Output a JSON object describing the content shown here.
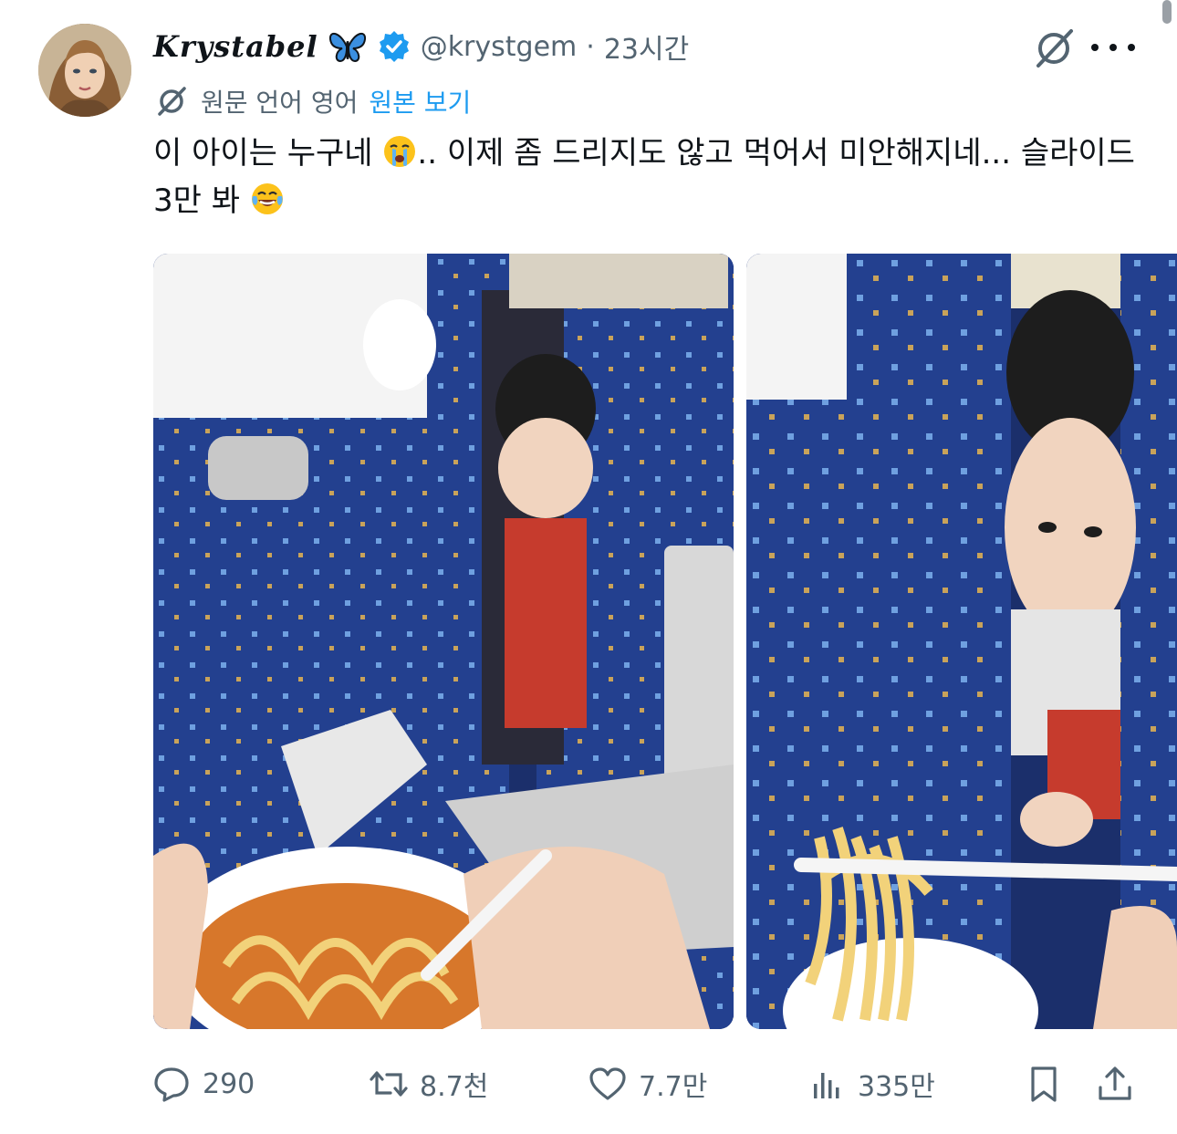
{
  "tweet": {
    "author": {
      "display_name": "Krystabel",
      "name_emoji": "butterfly-emoji",
      "handle": "@krystgem",
      "separator": "·",
      "timestamp": "23시간",
      "verified": true,
      "verified_color": "#1d9bf0"
    },
    "translation": {
      "notice": "원문 언어 영어",
      "show_original_label": "원본 보기",
      "link_color": "#1d9bf0"
    },
    "text": {
      "part1": "이 아이는 누구네 ",
      "emoji1": "loudly-crying-face-emoji",
      "part2": ".. 이제 좀 드리지도 않고 먹어서 미안해지네... 슬라이드 3만 봐 ",
      "emoji2": "face-with-tears-of-joy-emoji"
    },
    "media": [
      {
        "icon": "photo-baby-airplane-seat-ramen"
      },
      {
        "icon": "photo-baby-closeup-noodles"
      }
    ],
    "actions": {
      "reply_count": "290",
      "retweet_count": "8.7천",
      "like_count": "7.7만",
      "view_count": "335만"
    },
    "colors": {
      "text": "#0f1419",
      "secondary": "#536471",
      "seat_blue": "#1e3a8a"
    }
  }
}
